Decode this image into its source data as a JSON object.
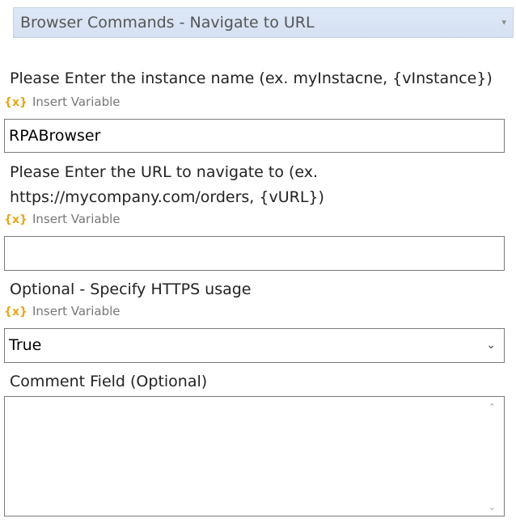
{
  "command_select": {
    "value": "Browser Commands - Navigate to URL",
    "arrow": "▾"
  },
  "insert_variable": {
    "icon": "{x}",
    "label": "Insert Variable"
  },
  "fields": {
    "instance": {
      "label": "Please Enter the instance name (ex. myInstacne, {vInstance})",
      "value": "RPABrowser"
    },
    "url": {
      "label_line1": "Please Enter the URL to navigate to (ex.",
      "label_line2": "https://mycompany.com/orders, {vURL})",
      "value": ""
    },
    "https": {
      "label": "Optional - Specify HTTPS usage",
      "value": "True",
      "chevron": "⌄"
    },
    "comment": {
      "label": "Comment Field (Optional)",
      "value": "",
      "scroll_up": "⌃",
      "scroll_down": "⌄"
    }
  }
}
